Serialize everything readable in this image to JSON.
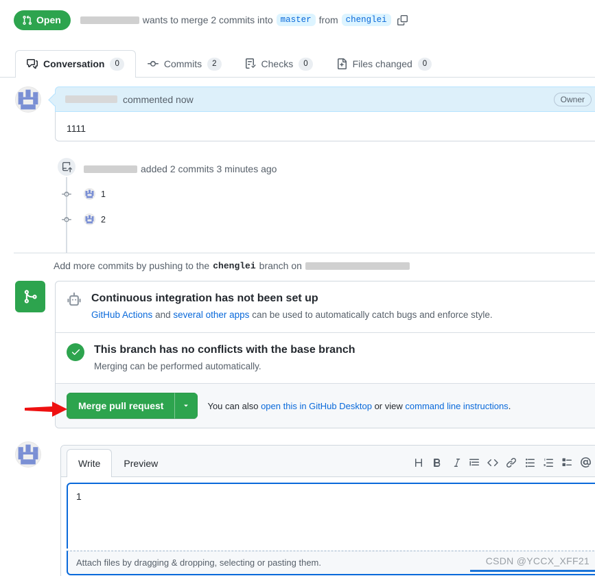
{
  "header": {
    "state_label": "Open",
    "state_color": "#2da44e",
    "wants_text": "wants to merge 2 commits into",
    "base_branch": "master",
    "from_text": "from",
    "head_branch": "chenglei",
    "copy_icon": "copy-icon"
  },
  "tabs": [
    {
      "label": "Conversation",
      "count": "0",
      "icon": "comment-discussion-icon",
      "active": true
    },
    {
      "label": "Commits",
      "count": "2",
      "icon": "git-commit-icon",
      "active": false
    },
    {
      "label": "Checks",
      "count": "0",
      "icon": "checklist-icon",
      "active": false
    },
    {
      "label": "Files changed",
      "count": "0",
      "icon": "file-diff-icon",
      "active": false
    }
  ],
  "comment": {
    "commented_text": "commented now",
    "owner_badge": "Owner",
    "body": "1111",
    "reaction_icon": "smiley-icon"
  },
  "timeline": {
    "push_text": "added 2 commits 3 minutes ago",
    "push_icon": "repo-push-icon",
    "commits": [
      {
        "message": "1"
      },
      {
        "message": "2"
      }
    ]
  },
  "add_commits": {
    "prefix": "Add more commits by pushing to the",
    "branch": "chenglei",
    "suffix": "branch on"
  },
  "merge_box": {
    "icon": "git-merge-icon",
    "ci": {
      "icon": "robot-icon",
      "title": "Continuous integration has not been set up",
      "sub_link_1": "GitHub Actions",
      "sub_mid": "and",
      "sub_link_2": "several other apps",
      "sub_tail": "can be used to automatically catch bugs and enforce style."
    },
    "conflict": {
      "icon": "check-icon",
      "title": "This branch has no conflicts with the base branch",
      "sub": "Merging can be performed automatically."
    },
    "action": {
      "merge_label": "Merge pull request",
      "caret_icon": "chevron-down-icon",
      "note_prefix": "You can also",
      "note_link_1": "open this in GitHub Desktop",
      "note_mid": "or view",
      "note_link_2": "command line instructions",
      "note_end": "."
    }
  },
  "editor": {
    "tabs": [
      {
        "label": "Write",
        "active": true
      },
      {
        "label": "Preview",
        "active": false
      }
    ],
    "toolbar": [
      "heading-icon",
      "bold-icon",
      "italic-icon",
      "quote-icon",
      "code-icon",
      "link-icon",
      "unordered-list-icon",
      "ordered-list-icon",
      "task-list-icon",
      "mention-icon",
      "reply-icon"
    ],
    "value": "1",
    "attach_text": "Attach files by dragging & dropping, selecting or pasting them."
  },
  "watermark": "CSDN @YCCX_XFF21",
  "accent_colors": {
    "green": "#2da44e",
    "blue_link": "#0969da",
    "chip_bg": "#ddf4ff",
    "comment_head_bg": "#ddf0fa",
    "annotation_red": "#ee1111"
  }
}
